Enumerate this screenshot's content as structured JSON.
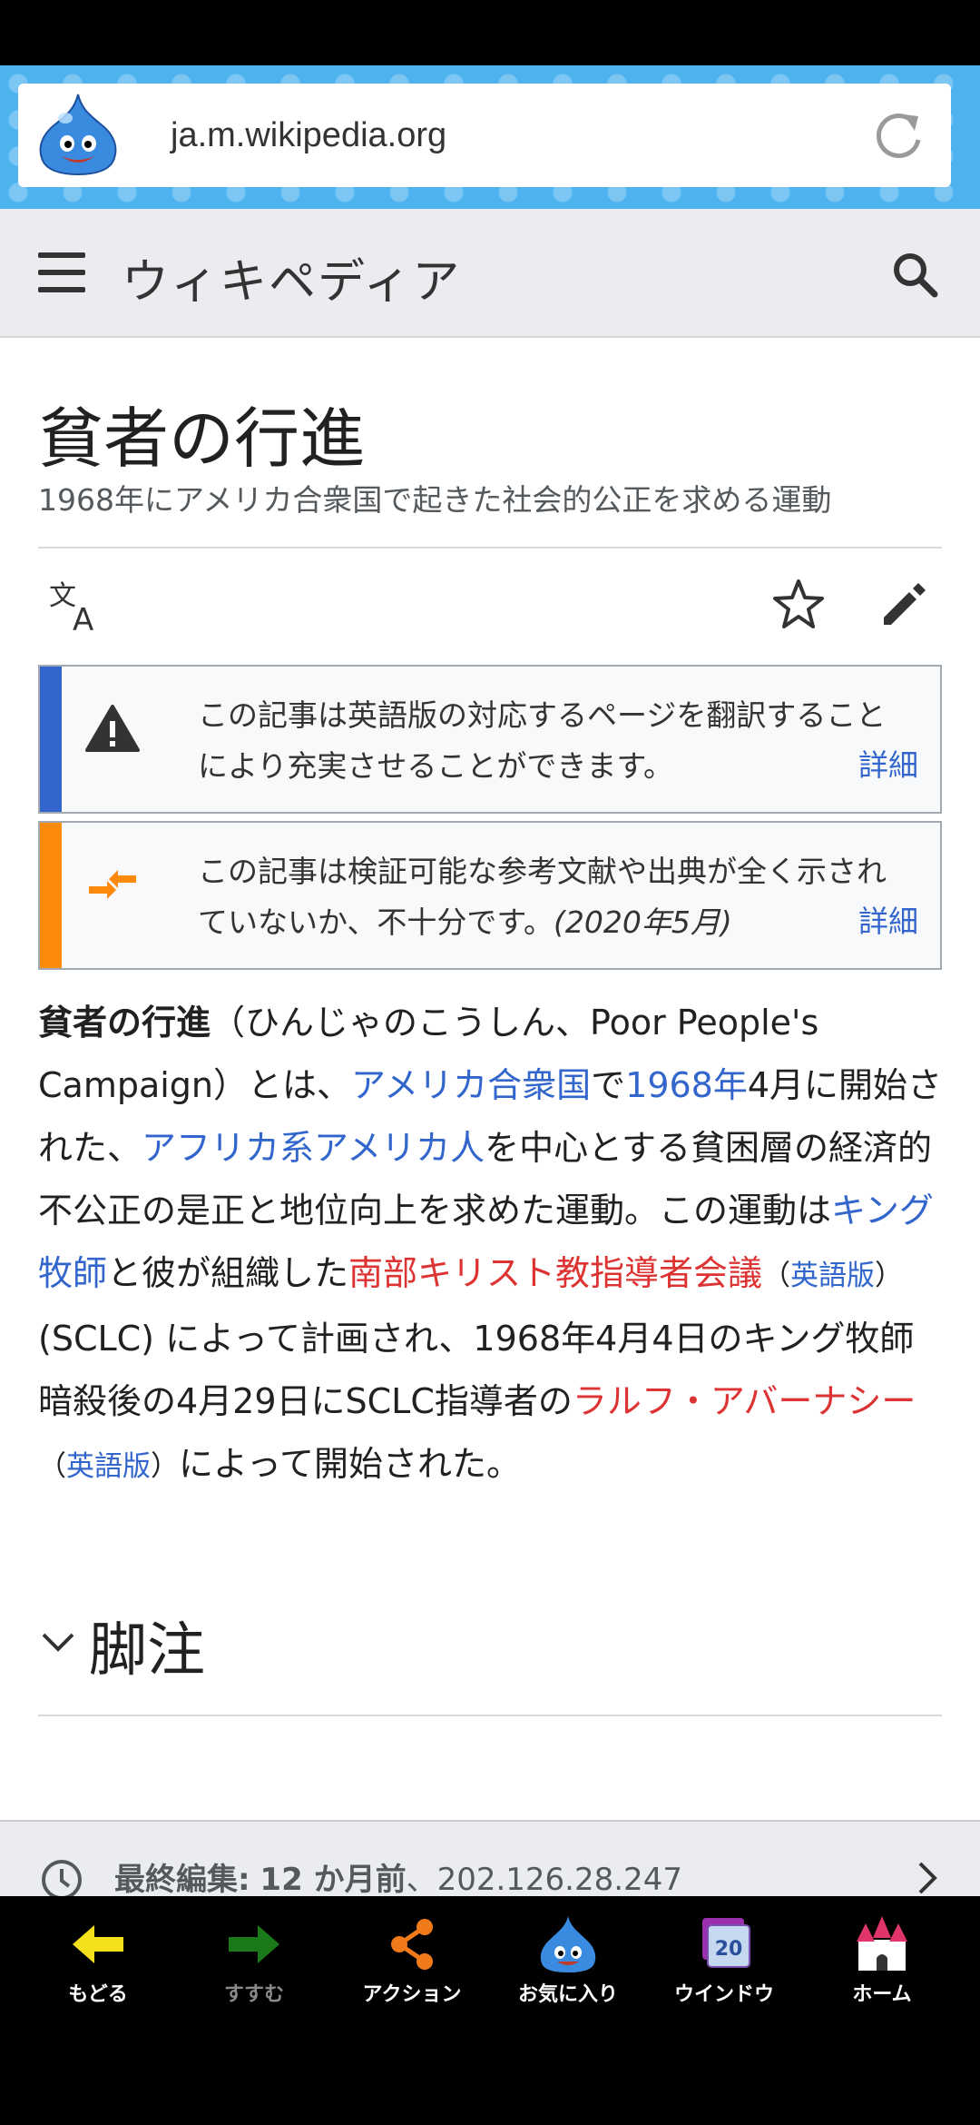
{
  "browser": {
    "url": "ja.m.wikipedia.org"
  },
  "header": {
    "logo_text": "ウィキペディア"
  },
  "article": {
    "title": "貧者の行進",
    "subtitle": "1968年にアメリカ合衆国で起きた社会的公正を求める運動",
    "notices": [
      {
        "text": "この記事は英語版の対応するページを翻訳することにより充実させることができます。",
        "more": "詳細",
        "color": "#3366cc"
      },
      {
        "text": "この記事は検証可能な参考文献や出典が全く示されていないか、不十分です。",
        "date": "(2020年5月)",
        "more": "詳細",
        "color": "#fc8a0c"
      }
    ],
    "body": {
      "bold_title": "貧者の行進",
      "t1": "（ひんじゃのこうしん、Poor People's Campaign）とは、",
      "link_usa": "アメリカ合衆国",
      "t2": "で",
      "link_1968": "1968年",
      "t3": "4月に開始された、",
      "link_african": "アフリカ系アメリカ人",
      "t4": "を中心とする貧困層の経済的不公正の是正と地位向上を求めた運動。この運動は",
      "link_king": "キング牧師",
      "t5": "と彼が組織した",
      "link_sclc": "南部キリスト教指導者会議",
      "paren_open": "（",
      "link_en1": "英語版",
      "paren_close": "）",
      "t6": " (SCLC) によって計画され、1968年4月4日のキング牧師暗殺後の4月29日にSCLC指導者の",
      "link_ralph": "ラルフ・アバーナシー",
      "link_en2": "英語版",
      "t7": "によって開始された。"
    },
    "section_title": "脚注",
    "last_edit_label": "最終編集:",
    "last_edit_time": "12 か月前",
    "last_edit_sep": "、",
    "last_edit_ip": "202.126.28.247"
  },
  "bottom_nav": {
    "back": "もどる",
    "forward": "すすむ",
    "action": "アクション",
    "favorites": "お気に入り",
    "window": "ウインドウ",
    "window_count": "20",
    "home": "ホーム"
  }
}
